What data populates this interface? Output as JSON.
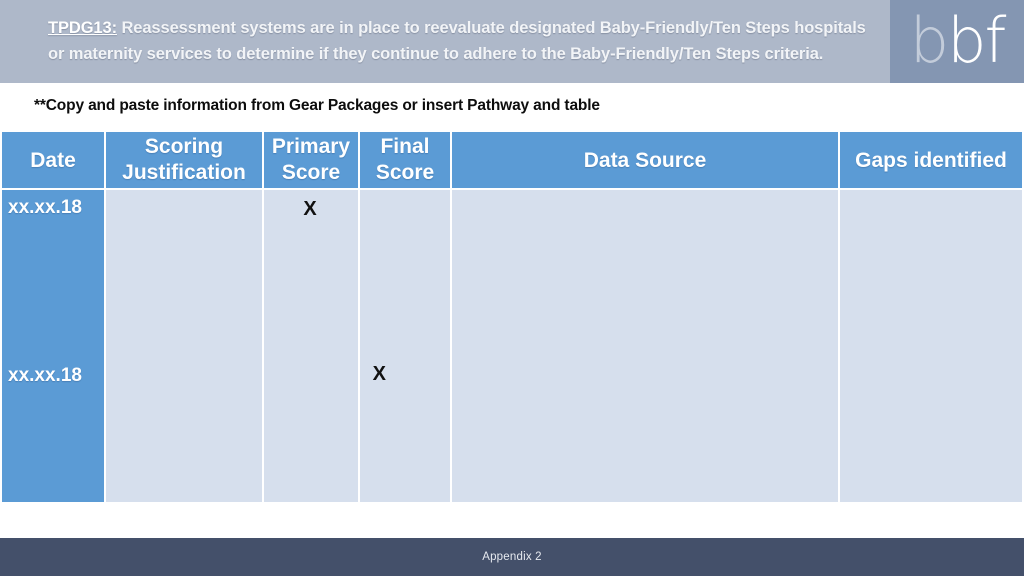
{
  "banner": {
    "code": "TPDG13:",
    "statement": " Reassessment systems are in place to reevaluate designated Baby-Friendly/Ten Steps hospitals or maternity services to determine if they continue to adhere to the Baby-Friendly/Ten Steps criteria.",
    "logo": {
      "letter_1": "b",
      "letter_2": "b",
      "letter_3": "f"
    },
    "colors": {
      "banner_background": "#aeb8c9",
      "logo_panel_background": "#8496b2",
      "banner_text": "#f2f4f7"
    }
  },
  "subnote": {
    "text": "**Copy and paste information from Gear Packages or insert Pathway and table"
  },
  "table": {
    "columns": [
      {
        "label": "Date"
      },
      {
        "label": "Scoring Justification"
      },
      {
        "label": "Primary Score"
      },
      {
        "label": "Final Score"
      },
      {
        "label": "Data Source"
      },
      {
        "label": "Gaps identified"
      }
    ],
    "dates": [
      "xx.xx.18",
      "xx.xx.18"
    ],
    "marks": {
      "primary_score": "X",
      "final_score": "X"
    },
    "cells": {
      "scoring_justification": "",
      "data_source": "",
      "gaps_identified": ""
    },
    "colors": {
      "header_background": "#5b9bd5",
      "body_background": "#d6dfed",
      "date_column_background": "#5b9bd5",
      "header_text": "#ffffff",
      "mark_text": "#111111"
    }
  },
  "footer": {
    "text": "Appendix 2",
    "colors": {
      "background": "#44506a",
      "text": "#e6e9ef"
    }
  }
}
